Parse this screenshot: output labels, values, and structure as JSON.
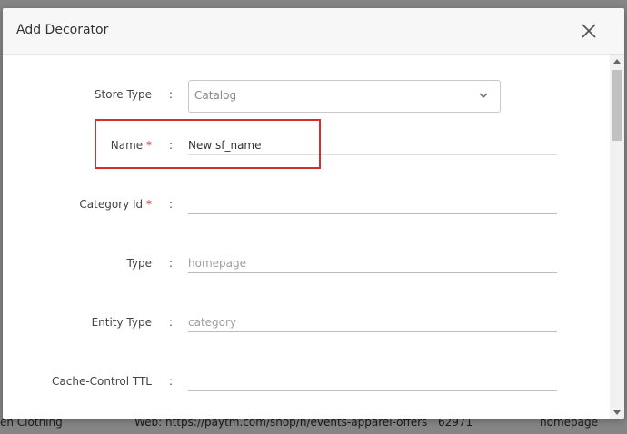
{
  "background": {
    "fragments": {
      "bottom_left": "en Clothing",
      "bottom_mid": "Web: https://paytm.com/shop/h/events-apparel-offers",
      "bottom_num": "62971",
      "bottom_right": "homepage"
    }
  },
  "modal": {
    "title": "Add Decorator",
    "fields": {
      "store_type": {
        "label": "Store Type",
        "value": "Catalog"
      },
      "name": {
        "label": "Name",
        "required_mark": "*",
        "value": "New sf_name"
      },
      "category_id": {
        "label": "Category Id",
        "required_mark": "*",
        "value": ""
      },
      "type": {
        "label": "Type",
        "placeholder": "homepage"
      },
      "entity_type": {
        "label": "Entity Type",
        "placeholder": "category"
      },
      "cache_control": {
        "label": "Cache-Control TTL",
        "value": ""
      }
    },
    "separator": ":"
  },
  "colors": {
    "required": "#c62828",
    "highlight": "#d32f2f"
  }
}
